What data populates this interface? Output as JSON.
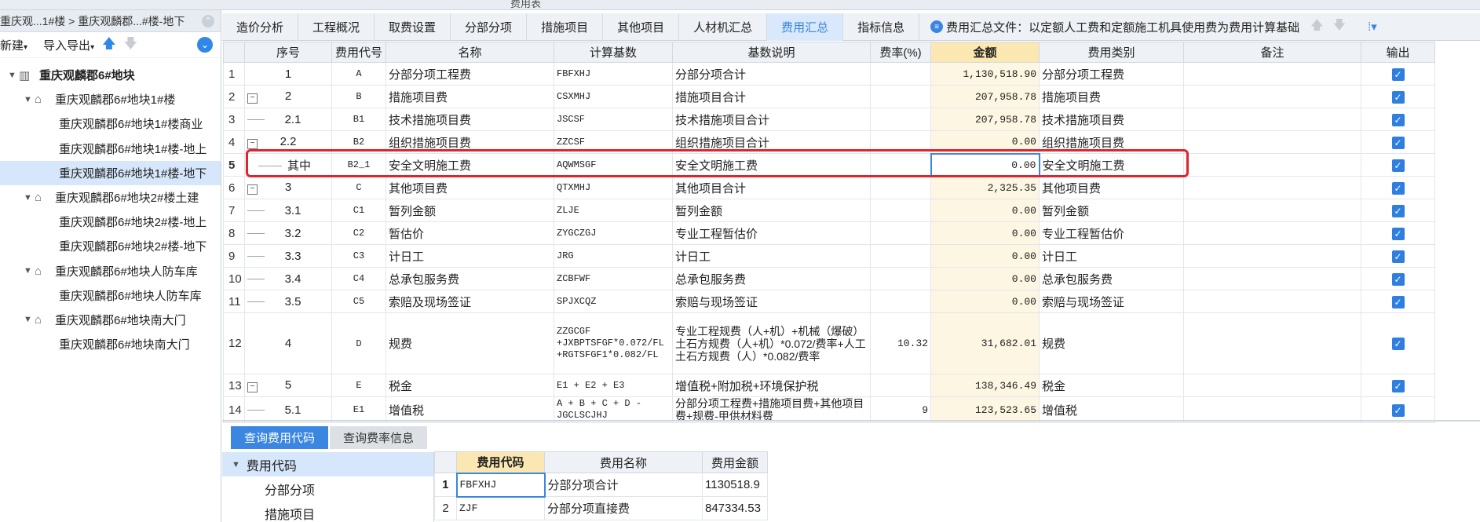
{
  "window_title": "费用表",
  "left": {
    "crumb": "重庆观...1#楼 > 重庆观麟郡...#楼-地下",
    "new_label": "新建",
    "importexport_label": "导入导出",
    "tree": [
      {
        "label": "重庆观麟郡6#地块",
        "level": 0
      },
      {
        "label": "重庆观麟郡6#地块1#楼",
        "level": 1
      },
      {
        "label": "重庆观麟郡6#地块1#楼商业",
        "level": 2
      },
      {
        "label": "重庆观麟郡6#地块1#楼-地上",
        "level": 2
      },
      {
        "label": "重庆观麟郡6#地块1#楼-地下",
        "level": 2,
        "selected": true
      },
      {
        "label": "重庆观麟郡6#地块2#楼土建",
        "level": 1
      },
      {
        "label": "重庆观麟郡6#地块2#楼-地上",
        "level": 2
      },
      {
        "label": "重庆观麟郡6#地块2#楼-地下",
        "level": 2
      },
      {
        "label": "重庆观麟郡6#地块人防车库",
        "level": 1
      },
      {
        "label": "重庆观麟郡6#地块人防车库",
        "level": 2
      },
      {
        "label": "重庆观麟郡6#地块南大门",
        "level": 1
      },
      {
        "label": "重庆观麟郡6#地块南大门",
        "level": 2
      }
    ]
  },
  "tabs": [
    "造价分析",
    "工程概况",
    "取费设置",
    "分部分项",
    "措施项目",
    "其他项目",
    "人材机汇总",
    "费用汇总",
    "指标信息"
  ],
  "active_tab": "费用汇总",
  "tab_info": "费用汇总文件：以定额人工费和定额施工机具使用费为费用计算基础",
  "columns": [
    "序号",
    "费用代号",
    "名称",
    "计算基数",
    "基数说明",
    "费率(%)",
    "金额",
    "费用类别",
    "备注",
    "输出"
  ],
  "rows": [
    {
      "n": "1",
      "seq": "1",
      "code": "A",
      "name": "分部分项工程费",
      "base": "FBFXHJ",
      "desc": "分部分项合计",
      "rate": "",
      "amount": "1,130,518.90",
      "cat": "分部分项工程费"
    },
    {
      "n": "2",
      "seq": "2",
      "code": "B",
      "name": "措施项目费",
      "base": "CSXMHJ",
      "desc": "措施项目合计",
      "rate": "",
      "amount": "207,958.78",
      "cat": "措施项目费"
    },
    {
      "n": "3",
      "seq": "2.1",
      "code": "B1",
      "name": "技术措施项目费",
      "base": "JSCSF",
      "desc": "技术措施项目合计",
      "rate": "",
      "amount": "207,958.78",
      "cat": "技术措施项目费"
    },
    {
      "n": "4",
      "seq": "2.2",
      "code": "B2",
      "name": "组织措施项目费",
      "base": "ZZCSF",
      "desc": "组织措施项目合计",
      "rate": "",
      "amount": "0.00",
      "cat": "组织措施项目费"
    },
    {
      "n": "5",
      "seq": "其中",
      "code": "B2_1",
      "name": "安全文明施工费",
      "base": "AQWMSGF",
      "desc": "安全文明施工费",
      "rate": "",
      "amount": "0.00",
      "cat": "安全文明施工费"
    },
    {
      "n": "6",
      "seq": "3",
      "code": "C",
      "name": "其他项目费",
      "base": "QTXMHJ",
      "desc": "其他项目合计",
      "rate": "",
      "amount": "2,325.35",
      "cat": "其他项目费"
    },
    {
      "n": "7",
      "seq": "3.1",
      "code": "C1",
      "name": "暂列金额",
      "base": "ZLJE",
      "desc": "暂列金额",
      "rate": "",
      "amount": "0.00",
      "cat": "暂列金额"
    },
    {
      "n": "8",
      "seq": "3.2",
      "code": "C2",
      "name": "暂估价",
      "base": "ZYGCZGJ",
      "desc": "专业工程暂估价",
      "rate": "",
      "amount": "0.00",
      "cat": "专业工程暂估价"
    },
    {
      "n": "9",
      "seq": "3.3",
      "code": "C3",
      "name": "计日工",
      "base": "JRG",
      "desc": "计日工",
      "rate": "",
      "amount": "0.00",
      "cat": "计日工"
    },
    {
      "n": "10",
      "seq": "3.4",
      "code": "C4",
      "name": "总承包服务费",
      "base": "ZCBFWF",
      "desc": "总承包服务费",
      "rate": "",
      "amount": "0.00",
      "cat": "总承包服务费"
    },
    {
      "n": "11",
      "seq": "3.5",
      "code": "C5",
      "name": "索赔及现场签证",
      "base": "SPJXCQZ",
      "desc": "索赔与现场签证",
      "rate": "",
      "amount": "0.00",
      "cat": "索赔与现场签证"
    },
    {
      "n": "12",
      "seq": "4",
      "code": "D",
      "name": "规费",
      "base": "ZZGCGF +JXBPTSFGF*0.072/FL +RGTSFGF1*0.082/FL",
      "desc": "专业工程规费（人+机）+机械（爆破）土石方规费（人+机）*0.072/费率+人工土石方规费（人）*0.082/费率",
      "rate": "10.32",
      "amount": "31,682.01",
      "cat": "规费"
    },
    {
      "n": "13",
      "seq": "5",
      "code": "E",
      "name": "税金",
      "base": "E1 + E2 + E3",
      "desc": "增值税+附加税+环境保护税",
      "rate": "",
      "amount": "138,346.49",
      "cat": "税金"
    },
    {
      "n": "14",
      "seq": "5.1",
      "code": "E1",
      "name": "增值税",
      "base": "A + B + C + D - JGCLSCJHJ",
      "desc": "分部分项工程费+措施项目费+其他项目费+规费-甲供材料费",
      "rate": "9",
      "amount": "123,523.65",
      "cat": "增值税"
    }
  ],
  "bottom": {
    "tabs": [
      "查询费用代码",
      "查询费率信息"
    ],
    "tree_root": "费用代码",
    "tree_items": [
      "分部分项",
      "措施项目"
    ],
    "columns": [
      "费用代码",
      "费用名称",
      "费用金额"
    ],
    "rows": [
      {
        "n": "1",
        "code": "FBFXHJ",
        "name": "分部分项合计",
        "amount": "1130518.9"
      },
      {
        "n": "2",
        "code": "ZJF",
        "name": "分部分项直接费",
        "amount": "847334.53"
      }
    ]
  }
}
